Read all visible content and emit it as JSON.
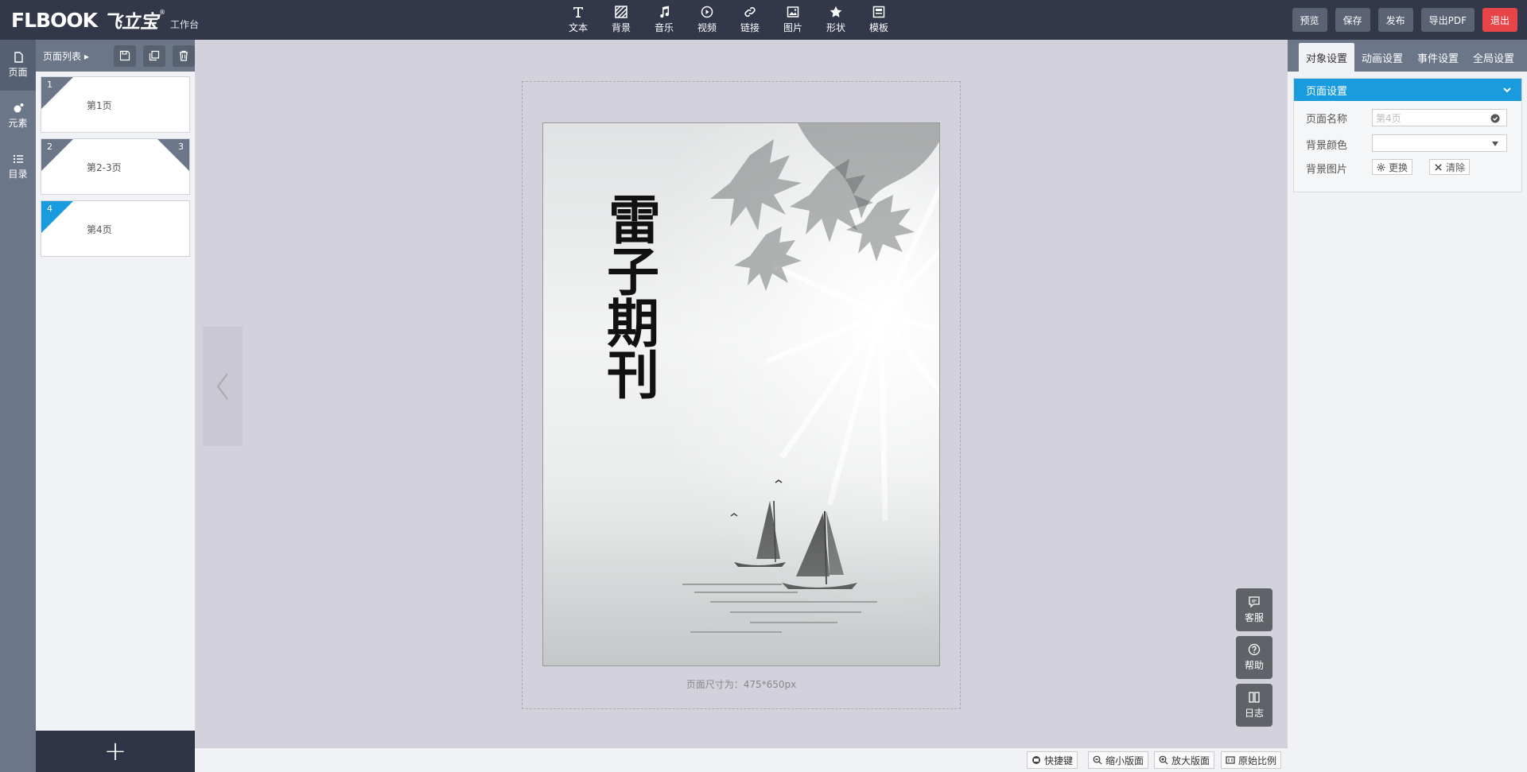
{
  "app": {
    "logo_text": "FLBOOK",
    "brand_text": "飞立宝",
    "subtitle": "工作台"
  },
  "toolbar": {
    "tools": [
      {
        "label": "文本",
        "icon": "text-icon"
      },
      {
        "label": "背景",
        "icon": "background-icon"
      },
      {
        "label": "音乐",
        "icon": "music-icon"
      },
      {
        "label": "视频",
        "icon": "video-icon"
      },
      {
        "label": "链接",
        "icon": "link-icon"
      },
      {
        "label": "图片",
        "icon": "image-icon"
      },
      {
        "label": "形状",
        "icon": "star-icon"
      },
      {
        "label": "模板",
        "icon": "template-icon"
      }
    ],
    "actions": {
      "preview": "预览",
      "save": "保存",
      "publish": "发布",
      "export_pdf": "导出PDF",
      "exit": "退出"
    }
  },
  "rail": {
    "items": [
      {
        "label": "页面",
        "icon": "page-icon",
        "active": true
      },
      {
        "label": "元素",
        "icon": "element-icon",
        "active": false
      },
      {
        "label": "目录",
        "icon": "list-icon",
        "active": false
      }
    ]
  },
  "page_list": {
    "title": "页面列表 ▸",
    "pages": [
      {
        "num_left": "1",
        "num_right": "",
        "label": "第1页",
        "active": false
      },
      {
        "num_left": "2",
        "num_right": "3",
        "label": "第2-3页",
        "active": false
      },
      {
        "num_left": "4",
        "num_right": "",
        "label": "第4页",
        "active": true
      }
    ],
    "add_label": "+"
  },
  "canvas": {
    "page_title": "雷子期刊",
    "size_label": "页面尺寸为：475*650px"
  },
  "bottom_bar": {
    "shortcuts": "快捷键",
    "zoom_out": "缩小版面",
    "zoom_in": "放大版面",
    "original": "原始比例"
  },
  "float": {
    "service": "客服",
    "help": "帮助",
    "log": "日志"
  },
  "right_panel": {
    "tabs": [
      {
        "label": "对象设置",
        "active": true
      },
      {
        "label": "动画设置",
        "active": false
      },
      {
        "label": "事件设置",
        "active": false
      },
      {
        "label": "全局设置",
        "active": false
      }
    ],
    "section_title": "页面设置",
    "page_name_label": "页面名称",
    "page_name_placeholder": "第4页",
    "bg_color_label": "背景颜色",
    "bg_image_label": "背景图片",
    "replace_label": "更换",
    "clear_label": "清除"
  },
  "colors": {
    "topbar": "#323749",
    "accent": "#1a9bde",
    "exit": "#e84548"
  }
}
